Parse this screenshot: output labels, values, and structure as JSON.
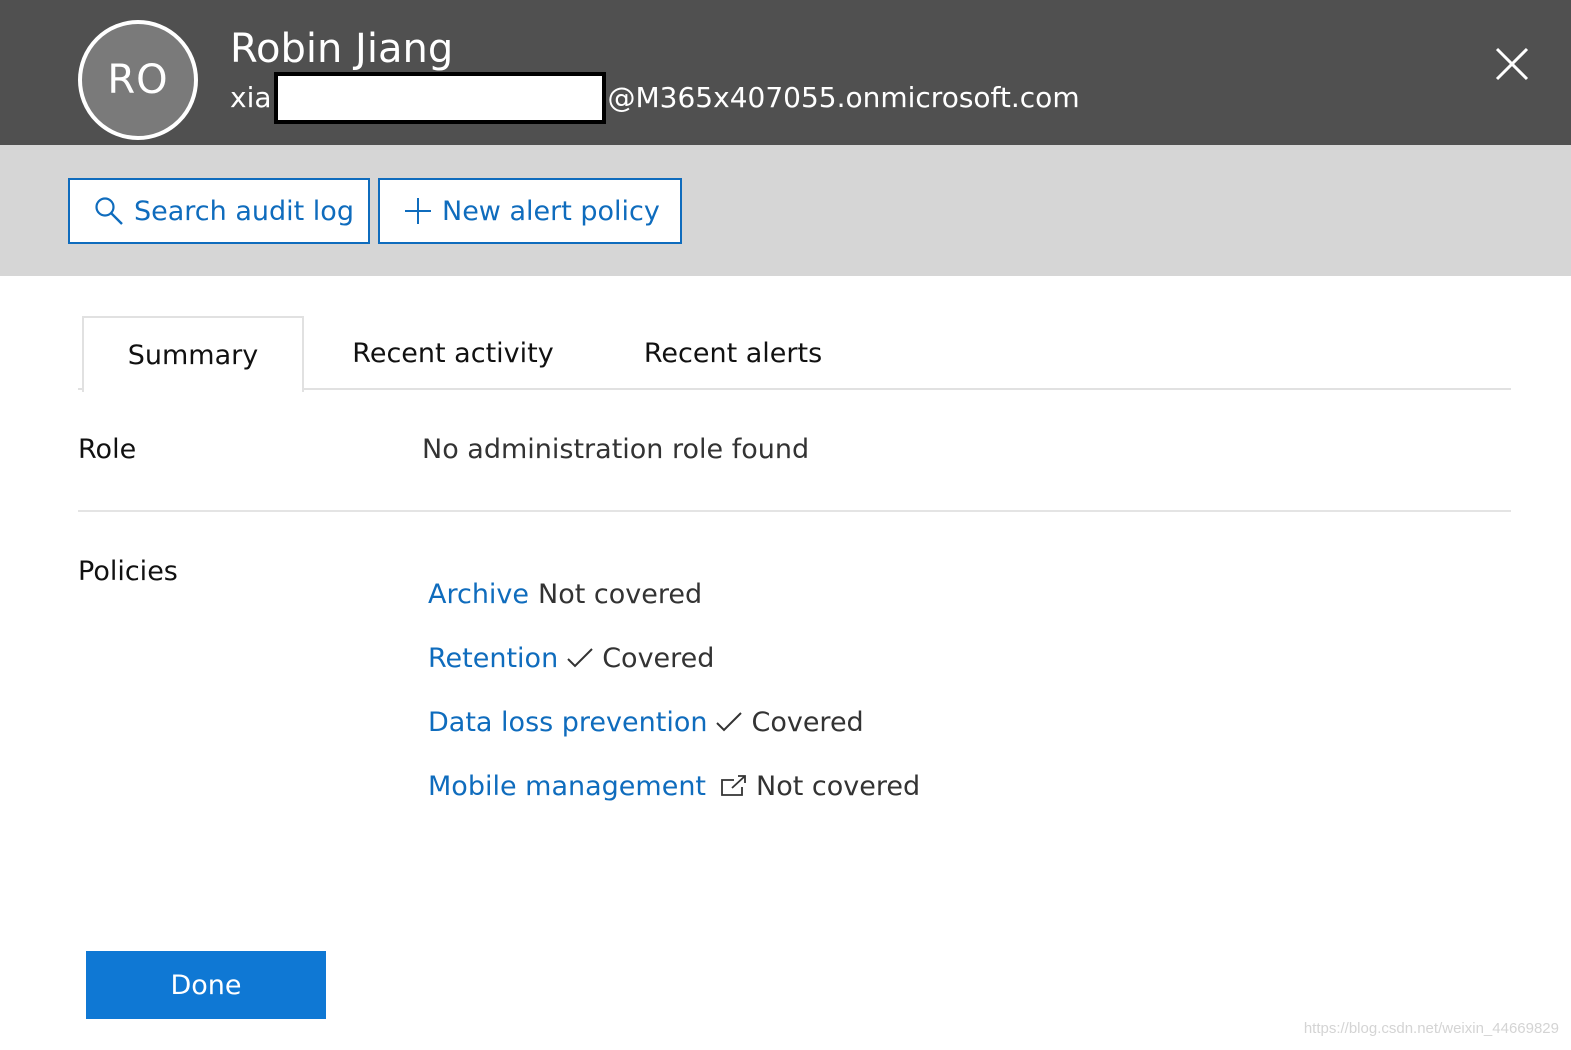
{
  "user": {
    "initials": "RO",
    "name": "Robin Jiang",
    "email_prefix": "xia",
    "email_domain": "@M365x407055.onmicrosoft.com"
  },
  "icons": {
    "close": "close-icon",
    "search": "search-icon",
    "plus": "plus-icon",
    "check": "check-icon",
    "external": "external-link-icon"
  },
  "toolbar": {
    "search_audit_log": "Search audit log",
    "new_alert_policy": "New alert policy"
  },
  "tabs": [
    {
      "label": "Summary",
      "selected": true
    },
    {
      "label": "Recent activity",
      "selected": false
    },
    {
      "label": "Recent alerts",
      "selected": false
    }
  ],
  "details": {
    "role_label": "Role",
    "role_value": "No administration role found",
    "policies_label": "Policies"
  },
  "policies": [
    {
      "name": "Archive",
      "status": "Not covered",
      "icon": ""
    },
    {
      "name": "Retention",
      "status": "Covered",
      "icon": "check-icon"
    },
    {
      "name": "Data loss prevention",
      "status": "Covered",
      "icon": "check-icon"
    },
    {
      "name": "Mobile management",
      "status": "Not covered",
      "icon": "external-link-icon"
    }
  ],
  "footer": {
    "done_label": "Done"
  },
  "watermark": "https://blog.csdn.net/weixin_44669829",
  "colors": {
    "header_bg": "#505050",
    "toolbar_bg": "#d6d6d6",
    "link": "#0f6cbd",
    "primary_button": "#0f78d4"
  }
}
